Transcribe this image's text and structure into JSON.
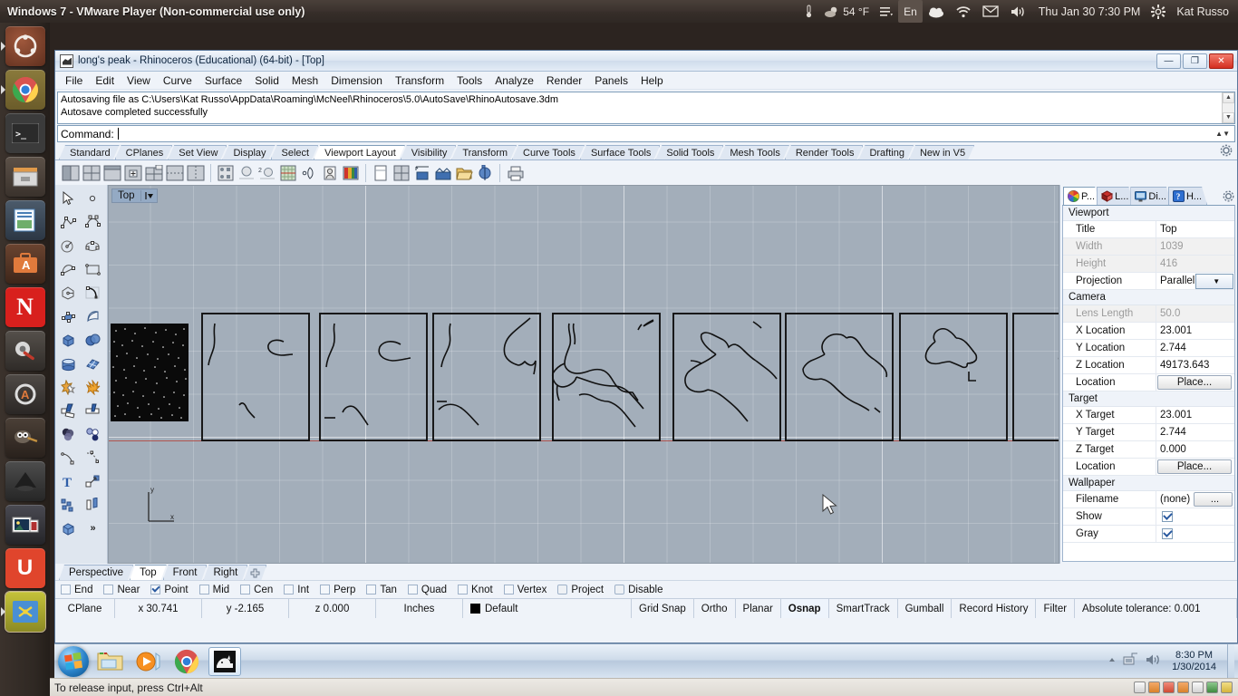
{
  "ubuntu_panel": {
    "vm_title": "Windows 7 - VMware Player (Non-commercial use only)",
    "temperature": "54 °F",
    "keyboard_layout": "En",
    "datetime": "Thu Jan 30  7:30 PM",
    "user": "Kat Russo",
    "icons": [
      "thermometer-icon",
      "weather-cloud-icon",
      "menu-indicator-icon",
      "keyboard-layout-icon",
      "dropbox-icon",
      "wifi-icon",
      "mail-icon",
      "volume-icon",
      "session-gear-icon"
    ]
  },
  "launcher": {
    "items": [
      {
        "name": "ubuntu-dash",
        "label": "Ubuntu Dash"
      },
      {
        "name": "google-chrome",
        "label": "Google Chrome"
      },
      {
        "name": "terminal",
        "label": "Terminal"
      },
      {
        "name": "files",
        "label": "Files"
      },
      {
        "name": "libreoffice-impress",
        "label": "LibreOffice Impress"
      },
      {
        "name": "ubuntu-software-center",
        "label": "Ubuntu Software Center"
      },
      {
        "name": "netflix",
        "label": "N"
      },
      {
        "name": "system-settings",
        "label": "System Settings"
      },
      {
        "name": "software-updater",
        "label": "Software Updater"
      },
      {
        "name": "gimp",
        "label": "GIMP"
      },
      {
        "name": "inkscape",
        "label": "Inkscape"
      },
      {
        "name": "shotwell",
        "label": "Shotwell"
      },
      {
        "name": "unity-app",
        "label": "U"
      },
      {
        "name": "vmware-player",
        "label": "VMware Player"
      }
    ]
  },
  "rhino": {
    "title": "long's peak - Rhinoceros (Educational) (64-bit) - [Top]",
    "window_buttons": {
      "minimize": "—",
      "maximize": "❐",
      "close": "✕"
    },
    "menu": [
      "File",
      "Edit",
      "View",
      "Curve",
      "Surface",
      "Solid",
      "Mesh",
      "Dimension",
      "Transform",
      "Tools",
      "Analyze",
      "Render",
      "Panels",
      "Help"
    ],
    "command_history": [
      "Autosaving file as C:\\Users\\Kat Russo\\AppData\\Roaming\\McNeel\\Rhinoceros\\5.0\\AutoSave\\RhinoAutosave.3dm",
      "Autosave completed successfully"
    ],
    "command_prompt": "Command:",
    "command_value": "",
    "toolbar_tabs": [
      "Standard",
      "CPlanes",
      "Set View",
      "Display",
      "Select",
      "Viewport Layout",
      "Visibility",
      "Transform",
      "Curve Tools",
      "Surface Tools",
      "Solid Tools",
      "Mesh Tools",
      "Render Tools",
      "Drafting",
      "New in V5"
    ],
    "toolbar_tab_active": "Viewport Layout",
    "viewport": {
      "label": "Top",
      "tabs": [
        "Perspective",
        "Top",
        "Front",
        "Right"
      ],
      "tab_active": "Top",
      "add_tab_label": "+",
      "axis_x_label": "x",
      "axis_y_label": "y"
    },
    "panel": {
      "tabs": [
        {
          "name": "properties",
          "label": "P...",
          "icon": "color-wheel-icon"
        },
        {
          "name": "layers",
          "label": "L...",
          "icon": "layers-icon"
        },
        {
          "name": "display",
          "label": "Di...",
          "icon": "monitor-icon"
        },
        {
          "name": "help",
          "label": "H...",
          "icon": "help-icon"
        }
      ],
      "tab_active": "properties",
      "groups": [
        {
          "title": "Viewport",
          "rows": [
            {
              "key": "Title",
              "value": "Top",
              "type": "text",
              "disabled": false
            },
            {
              "key": "Width",
              "value": "1039",
              "type": "text",
              "disabled": true
            },
            {
              "key": "Height",
              "value": "416",
              "type": "text",
              "disabled": true
            },
            {
              "key": "Projection",
              "value": "Parallel",
              "type": "dropdown",
              "disabled": false
            }
          ]
        },
        {
          "title": "Camera",
          "rows": [
            {
              "key": "Lens Length",
              "value": "50.0",
              "type": "text",
              "disabled": true
            },
            {
              "key": "X Location",
              "value": "23.001",
              "type": "text",
              "disabled": false
            },
            {
              "key": "Y Location",
              "value": "2.744",
              "type": "text",
              "disabled": false
            },
            {
              "key": "Z Location",
              "value": "49173.643",
              "type": "text",
              "disabled": false
            },
            {
              "key": "Location",
              "value": "Place...",
              "type": "button",
              "disabled": false
            }
          ]
        },
        {
          "title": "Target",
          "rows": [
            {
              "key": "X Target",
              "value": "23.001",
              "type": "text",
              "disabled": false
            },
            {
              "key": "Y Target",
              "value": "2.744",
              "type": "text",
              "disabled": false
            },
            {
              "key": "Z Target",
              "value": "0.000",
              "type": "text",
              "disabled": false
            },
            {
              "key": "Location",
              "value": "Place...",
              "type": "button",
              "disabled": false
            }
          ]
        },
        {
          "title": "Wallpaper",
          "rows": [
            {
              "key": "Filename",
              "value": "(none)",
              "type": "filepicker",
              "disabled": false
            },
            {
              "key": "Show",
              "value": "",
              "type": "checkbox",
              "checked": true,
              "disabled": false
            },
            {
              "key": "Gray",
              "value": "",
              "type": "checkbox",
              "checked": true,
              "disabled": false
            }
          ]
        }
      ]
    },
    "osnaps": [
      {
        "label": "End",
        "checked": false
      },
      {
        "label": "Near",
        "checked": false
      },
      {
        "label": "Point",
        "checked": true
      },
      {
        "label": "Mid",
        "checked": false
      },
      {
        "label": "Cen",
        "checked": false
      },
      {
        "label": "Int",
        "checked": false
      },
      {
        "label": "Perp",
        "checked": false
      },
      {
        "label": "Tan",
        "checked": false
      },
      {
        "label": "Quad",
        "checked": false
      },
      {
        "label": "Knot",
        "checked": false
      },
      {
        "label": "Vertex",
        "checked": false
      },
      {
        "label": "Project",
        "checked": false
      },
      {
        "label": "Disable",
        "checked": false
      }
    ],
    "statusbar": {
      "cplane": "CPlane",
      "x": "x 30.741",
      "y": "y -2.165",
      "z": "z 0.000",
      "units": "Inches",
      "layer": "Default",
      "toggles": [
        {
          "label": "Grid Snap",
          "active": false
        },
        {
          "label": "Ortho",
          "active": false
        },
        {
          "label": "Planar",
          "active": false
        },
        {
          "label": "Osnap",
          "active": true
        },
        {
          "label": "SmartTrack",
          "active": false
        },
        {
          "label": "Gumball",
          "active": false
        },
        {
          "label": "Record History",
          "active": false
        },
        {
          "label": "Filter",
          "active": false
        }
      ],
      "tolerance": "Absolute tolerance: 0.001"
    }
  },
  "windows_taskbar": {
    "start_label": "Start",
    "apps": [
      {
        "name": "windows-explorer",
        "label": "Windows Explorer"
      },
      {
        "name": "windows-media-player",
        "label": "Windows Media Player"
      },
      {
        "name": "google-chrome",
        "label": "Google Chrome"
      },
      {
        "name": "rhinoceros",
        "label": "Rhinoceros"
      }
    ],
    "tray_icons": [
      "show-hidden-icon",
      "network-icon",
      "volume-icon"
    ],
    "time": "8:30 PM",
    "date": "1/30/2014"
  },
  "vmware_status": {
    "message": "To release input, press Ctrl+Alt",
    "device_icons": [
      "hard-disk-icon",
      "cd-drive-icon",
      "floppy-icon",
      "network-adapter-icon",
      "printer-icon",
      "usb-icon",
      "sound-icon"
    ]
  },
  "colors": {
    "viewport_bg": "#a3aeba",
    "axis_red": "#b1544f",
    "accent_blue": "#7f9db9",
    "ubuntu_panel": "#3c332e"
  }
}
